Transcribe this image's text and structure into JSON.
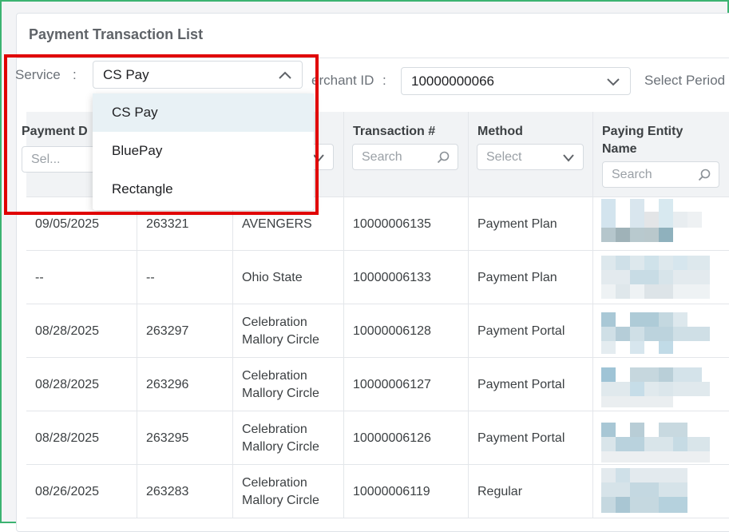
{
  "panel": {
    "title": "Payment Transaction List"
  },
  "filters": {
    "service_label": "Service",
    "service_sep": ":",
    "service_value": "CS Pay",
    "merchant_label": "erchant ID",
    "merchant_sep": ":",
    "merchant_value": "10000000066",
    "period_label": "Select Period"
  },
  "dropdown": {
    "options": [
      "CS Pay",
      "BluePay",
      "Rectangle"
    ],
    "selected": "CS Pay"
  },
  "table": {
    "headers": [
      {
        "label": "Payment D",
        "filter": "Sel..."
      },
      {
        "label": "",
        "filter": ""
      },
      {
        "label": "",
        "filter": ""
      },
      {
        "label": "Transaction #",
        "filter": "Search"
      },
      {
        "label": "Method",
        "filter": "Select"
      },
      {
        "label": "Paying Entity Name",
        "filter": "Search"
      }
    ],
    "rows": [
      {
        "date": "09/05/2025",
        "id": "263321",
        "entity": "AVENGERS",
        "txn": "10000006135",
        "method": "Payment Plan"
      },
      {
        "date": "--",
        "id": "--",
        "entity": "Ohio State",
        "txn": "10000006133",
        "method": "Payment Plan"
      },
      {
        "date": "08/28/2025",
        "id": "263297",
        "entity": "Celebration Mallory Circle",
        "txn": "10000006128",
        "method": "Payment Portal"
      },
      {
        "date": "08/28/2025",
        "id": "263296",
        "entity": "Celebration Mallory Circle",
        "txn": "10000006127",
        "method": "Payment Portal"
      },
      {
        "date": "08/28/2025",
        "id": "263295",
        "entity": "Celebration Mallory Circle",
        "txn": "10000006126",
        "method": "Payment Portal"
      },
      {
        "date": "08/26/2025",
        "id": "263283",
        "entity": "Celebration Mallory Circle",
        "txn": "10000006119",
        "method": "Regular"
      }
    ]
  },
  "colors": {
    "highlight": "#e00000",
    "frame": "#3cb371",
    "active_option": "#e8f1f5"
  }
}
